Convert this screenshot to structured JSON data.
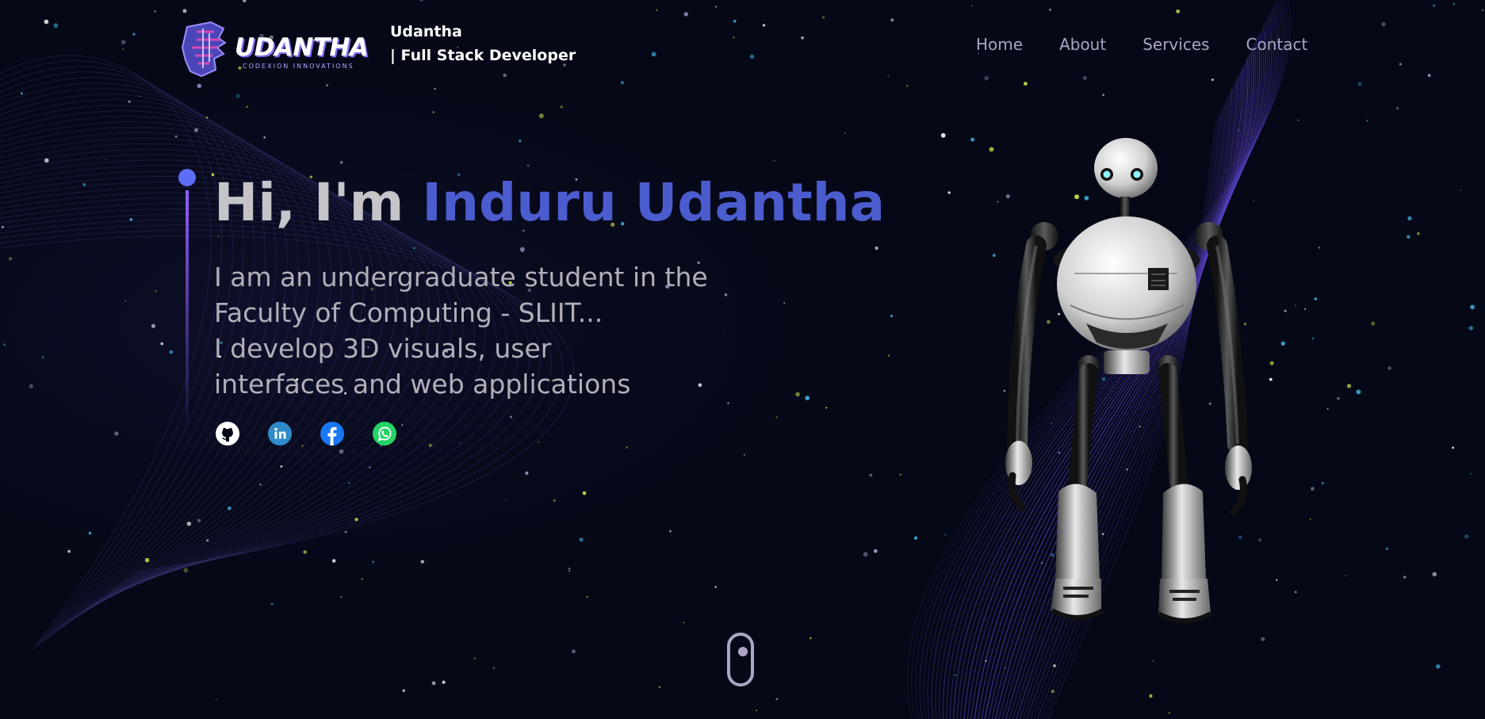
{
  "header": {
    "logo_text": "UDANTHA",
    "logo_subtext": "CODEXION INNOVATIONS",
    "brand_name": "Udantha",
    "brand_role": "| Full Stack Developer"
  },
  "nav": {
    "items": [
      "Home",
      "About",
      "Services",
      "Contact"
    ]
  },
  "hero": {
    "greeting_prefix": "Hi, I'm ",
    "name": "Induru Udantha",
    "intro_lines": [
      "I am an undergraduate student in the",
      "Faculty of Computing - SLIIT...",
      "I develop 3D visuals, user",
      "interfaces and web applications"
    ]
  },
  "socials": {
    "icons": [
      "github-icon",
      "linkedin-icon",
      "facebook-icon",
      "whatsapp-icon"
    ]
  },
  "colors": {
    "background": "#050816",
    "accent": "#4b5ccf",
    "timeline": "#915eff",
    "nav_text": "#aaa6c3",
    "heading_text": "#c4c4c9"
  }
}
